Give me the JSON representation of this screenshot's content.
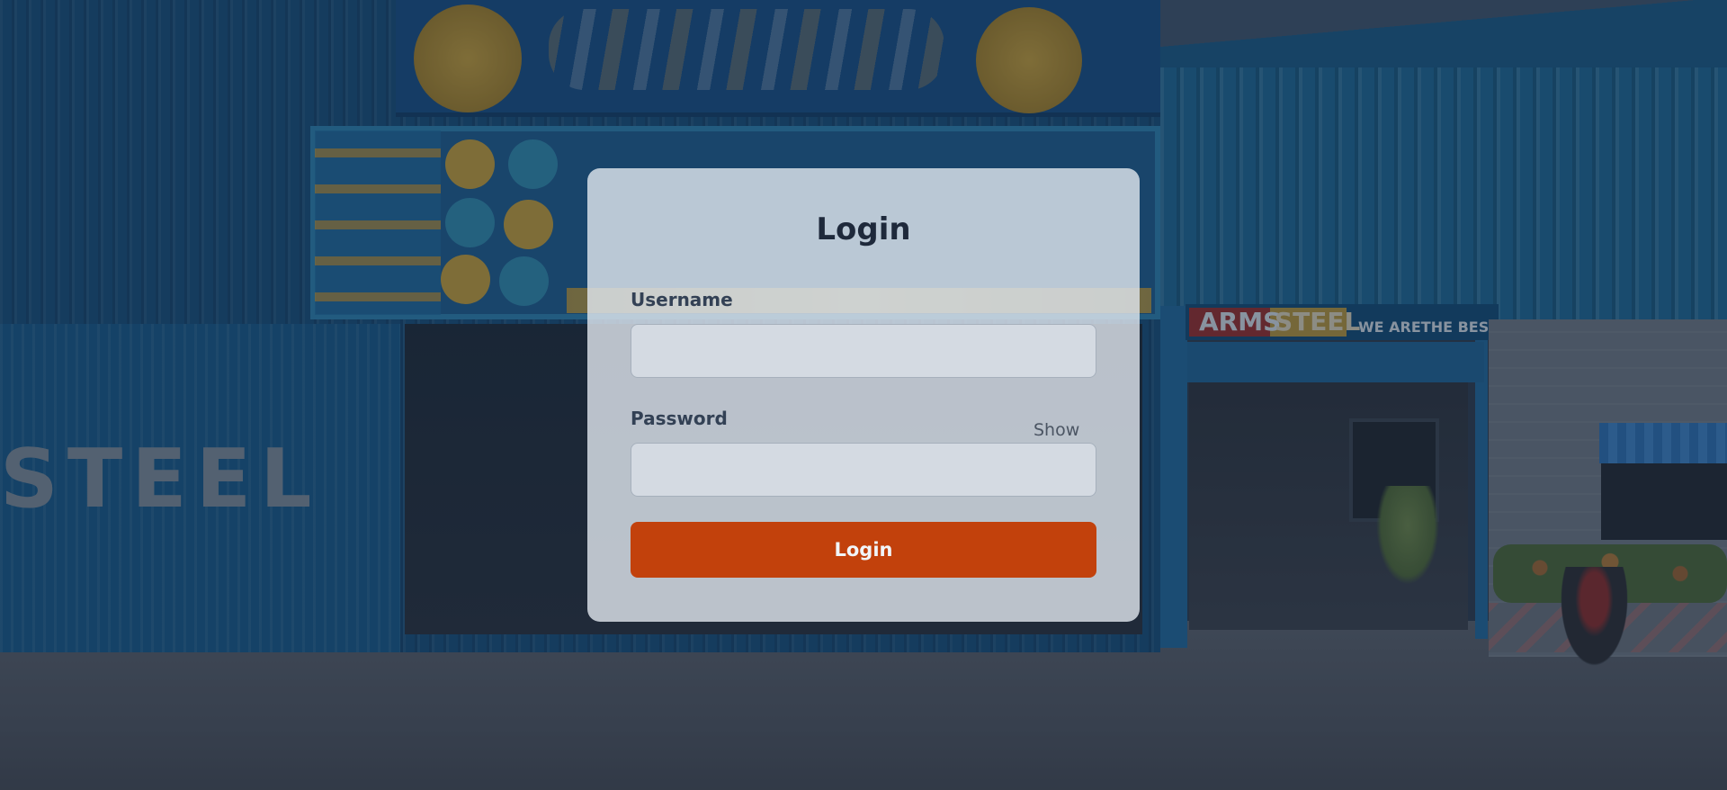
{
  "background": {
    "image_subject": "steel-shop-storefront",
    "overlay_color": "#182232",
    "sign_text_left": "STEEL",
    "shop_sign": {
      "arms": "ARMS",
      "steel": "STEEL",
      "tagline": "WE ARETHE BEST"
    }
  },
  "login_card": {
    "title": "Login",
    "username": {
      "label": "Username",
      "value": "",
      "placeholder": ""
    },
    "password": {
      "label": "Password",
      "value": "",
      "placeholder": "",
      "toggle_label": "Show"
    },
    "submit_label": "Login",
    "colors": {
      "accent": "#c2410c",
      "card_bg": "#e2e8f0",
      "title": "#1e293b",
      "label": "#334155"
    }
  }
}
